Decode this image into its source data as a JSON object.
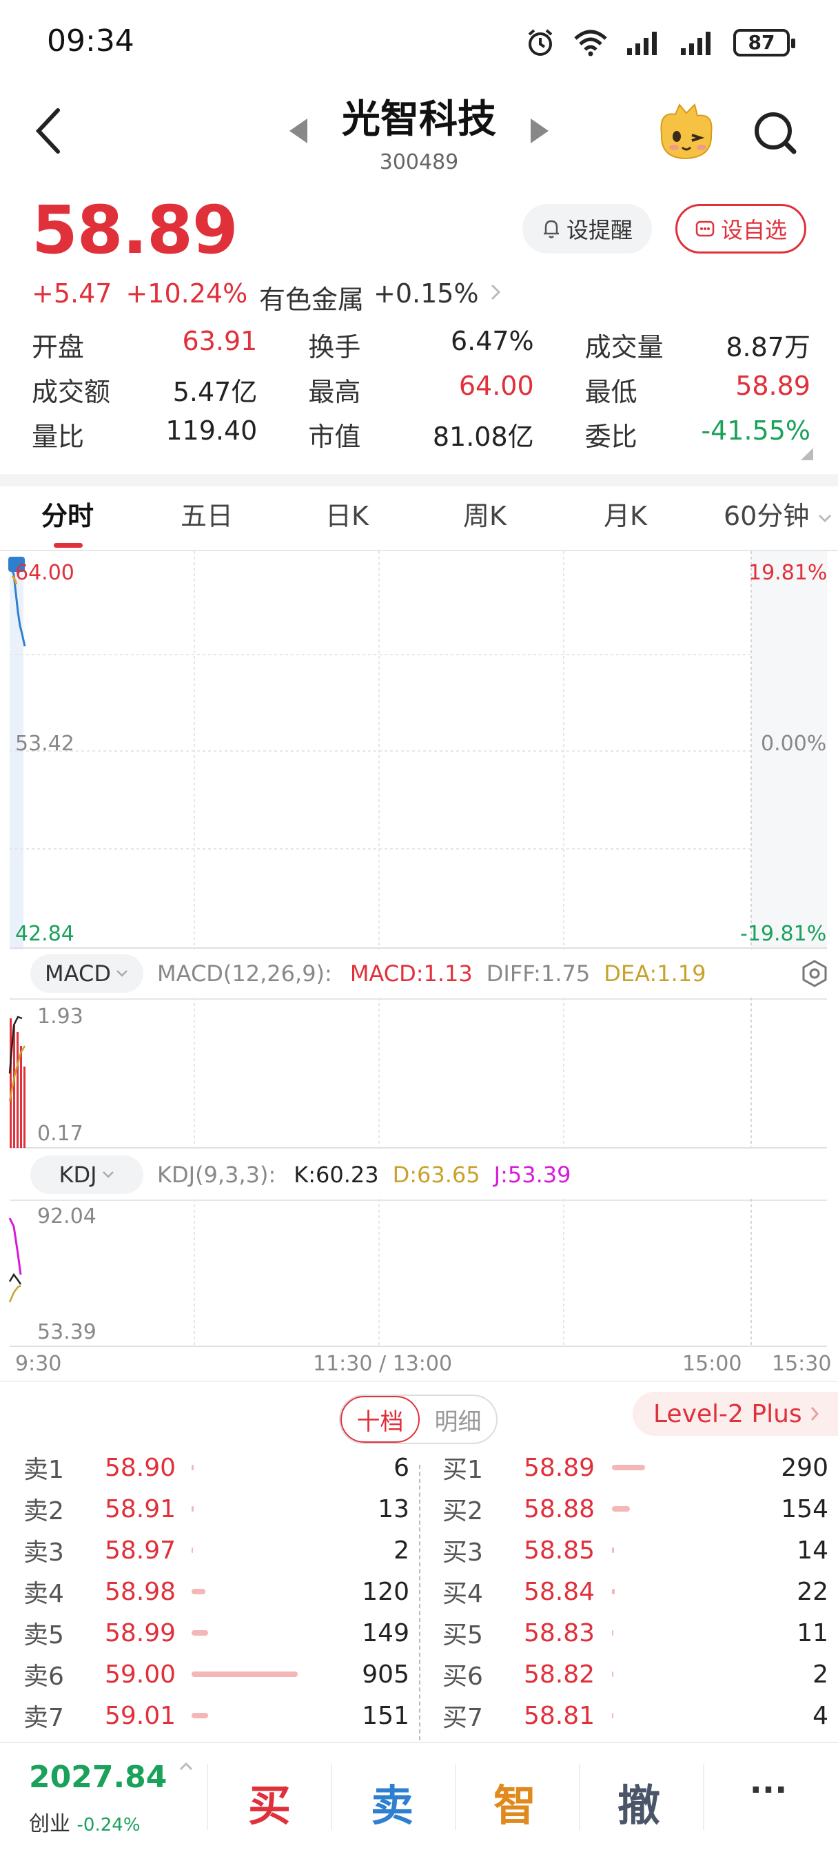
{
  "status": {
    "time": "09:34",
    "battery": "87"
  },
  "header": {
    "title": "光智科技",
    "code": "300489"
  },
  "quote": {
    "price": "58.89",
    "change": "+5.47",
    "change_pct": "+10.24%",
    "sector_name": "有色金属",
    "sector_change": "+0.15%",
    "remind_label": "设提醒",
    "watch_label": "设自选"
  },
  "stats": [
    [
      {
        "label": "开盘",
        "value": "63.91",
        "color": "red"
      },
      {
        "label": "换手",
        "value": "6.47%",
        "color": "black"
      },
      {
        "label": "成交量",
        "value": "8.87万",
        "color": "black"
      }
    ],
    [
      {
        "label": "成交额",
        "value": "5.47亿",
        "color": "black"
      },
      {
        "label": "最高",
        "value": "64.00",
        "color": "red"
      },
      {
        "label": "最低",
        "value": "58.89",
        "color": "red"
      }
    ],
    [
      {
        "label": "量比",
        "value": "119.40",
        "color": "black"
      },
      {
        "label": "市值",
        "value": "81.08亿",
        "color": "black"
      },
      {
        "label": "委比",
        "value": "-41.55%",
        "color": "green"
      }
    ]
  ],
  "tabs": [
    "分时",
    "五日",
    "日K",
    "周K",
    "月K",
    "60分钟"
  ],
  "intraday": {
    "price_high": "64.00",
    "price_mid": "53.42",
    "price_low": "42.84",
    "pct_high": "19.81%",
    "pct_mid": "0.00%",
    "pct_low": "-19.81%"
  },
  "macd": {
    "selector": "MACD",
    "params": "MACD(12,26,9):",
    "macd": "MACD:1.13",
    "diff": "DIFF:1.75",
    "dea": "DEA:1.19",
    "axis_high": "1.93",
    "axis_low": "0.17"
  },
  "kdj": {
    "selector": "KDJ",
    "params": "KDJ(9,3,3):",
    "k": "K:60.23",
    "d": "D:63.65",
    "j": "J:53.39",
    "axis_high": "92.04",
    "axis_low": "53.39"
  },
  "time_axis": {
    "start": "9:30",
    "mid": "11:30 / 13:00",
    "t15": "15:00",
    "end": "15:30"
  },
  "orderbook": {
    "tab_active": "十档",
    "tab_inactive": "明细",
    "level2": "Level-2 Plus",
    "sell": [
      {
        "label": "卖1",
        "price": "58.90",
        "vol": "6"
      },
      {
        "label": "卖2",
        "price": "58.91",
        "vol": "13"
      },
      {
        "label": "卖3",
        "price": "58.97",
        "vol": "2"
      },
      {
        "label": "卖4",
        "price": "58.98",
        "vol": "120"
      },
      {
        "label": "卖5",
        "price": "58.99",
        "vol": "149"
      },
      {
        "label": "卖6",
        "price": "59.00",
        "vol": "905"
      },
      {
        "label": "卖7",
        "price": "59.01",
        "vol": "151"
      }
    ],
    "buy": [
      {
        "label": "买1",
        "price": "58.89",
        "vol": "290"
      },
      {
        "label": "买2",
        "price": "58.88",
        "vol": "154"
      },
      {
        "label": "买3",
        "price": "58.85",
        "vol": "14"
      },
      {
        "label": "买4",
        "price": "58.84",
        "vol": "22"
      },
      {
        "label": "买5",
        "price": "58.83",
        "vol": "11"
      },
      {
        "label": "买6",
        "price": "58.82",
        "vol": "2"
      },
      {
        "label": "买7",
        "price": "58.81",
        "vol": "4"
      }
    ]
  },
  "bottom": {
    "index_value": "2027.84",
    "index_name": "创业",
    "index_change": "-0.24%",
    "buy": "买",
    "sell": "卖",
    "smart": "智",
    "cancel": "撤",
    "more": "···"
  },
  "colors": {
    "red": "#e0303a",
    "green": "#1aa15a",
    "gold": "#c9a22c",
    "blue": "#2f7fd0",
    "magenta": "#d81bd8"
  }
}
